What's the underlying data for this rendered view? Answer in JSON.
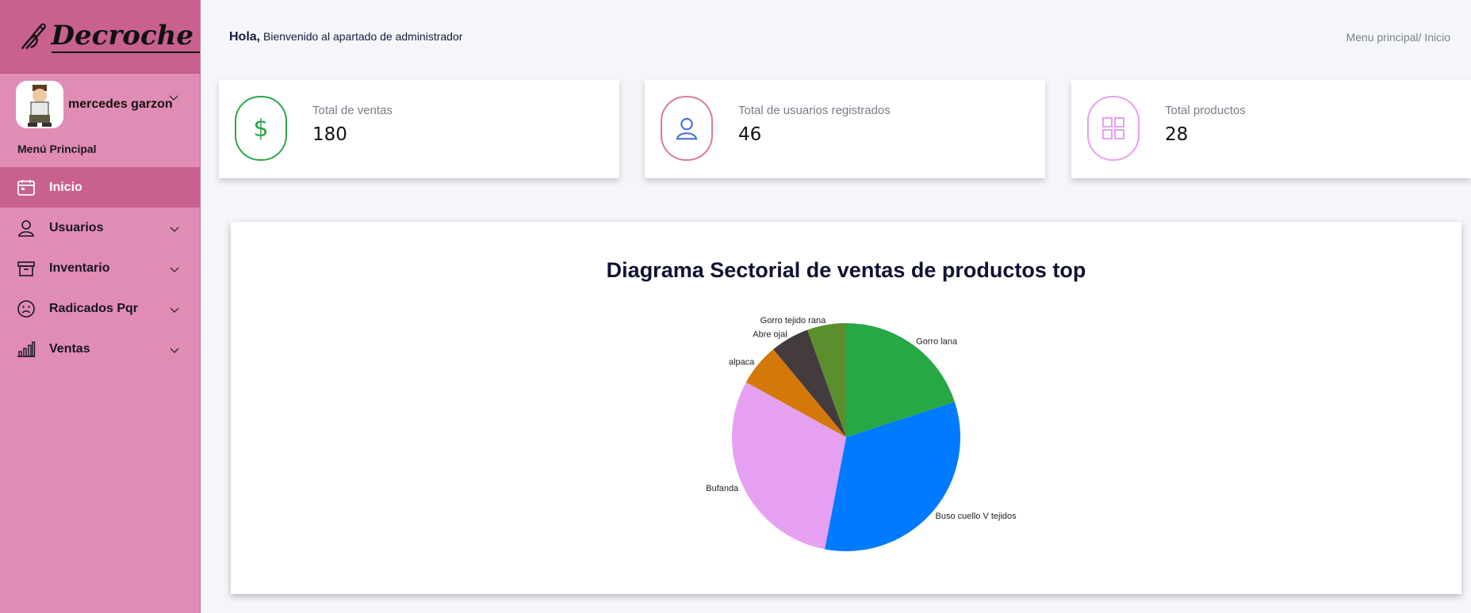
{
  "app": {
    "brand": "Decroche"
  },
  "user": {
    "name": "mercedes garzon"
  },
  "sidebar": {
    "section_title": "Menú Principal",
    "items": [
      {
        "label": "Inicio",
        "icon": "calendar-icon",
        "active": true,
        "expandable": false
      },
      {
        "label": "Usuarios",
        "icon": "user-icon",
        "active": false,
        "expandable": true
      },
      {
        "label": "Inventario",
        "icon": "archive-box-icon",
        "active": false,
        "expandable": true
      },
      {
        "label": "Radicados Pqr",
        "icon": "sad-face-icon",
        "active": false,
        "expandable": true
      },
      {
        "label": "Ventas",
        "icon": "bar-chart-icon",
        "active": false,
        "expandable": true
      }
    ]
  },
  "header": {
    "greeting_bold": "Hola,",
    "greeting_text": " Bienvenido al apartado de administrador",
    "breadcrumb_parent": "Menu principal/",
    "breadcrumb_current": "Inicio"
  },
  "cards": [
    {
      "label": "Total de ventas",
      "value": "180",
      "icon": "dollar-icon",
      "color": "#2aa84a"
    },
    {
      "label": "Total de usuarios registrados",
      "value": "46",
      "icon": "user-icon",
      "color": "#d97aa0"
    },
    {
      "label": "Total productos",
      "value": "28",
      "icon": "grid-icon",
      "color": "#e6a0ee"
    }
  ],
  "chart_data": {
    "type": "pie",
    "title": "Diagrama Sectorial de ventas de productos top",
    "slices": [
      {
        "label": "Gorro lana",
        "value": 20,
        "color": "#28a745"
      },
      {
        "label": "Buso cuello V tejidos",
        "value": 33,
        "color": "#007bff"
      },
      {
        "label": "Bufanda",
        "value": 30,
        "color": "#e6a0f2"
      },
      {
        "label": "alpaca",
        "value": 6,
        "color": "#d4780a"
      },
      {
        "label": "Abre ojal",
        "value": 5.5,
        "color": "#433b3d"
      },
      {
        "label": "Gorro tejido rana",
        "value": 5.5,
        "color": "#5b8f2e"
      }
    ],
    "legend": "none"
  }
}
